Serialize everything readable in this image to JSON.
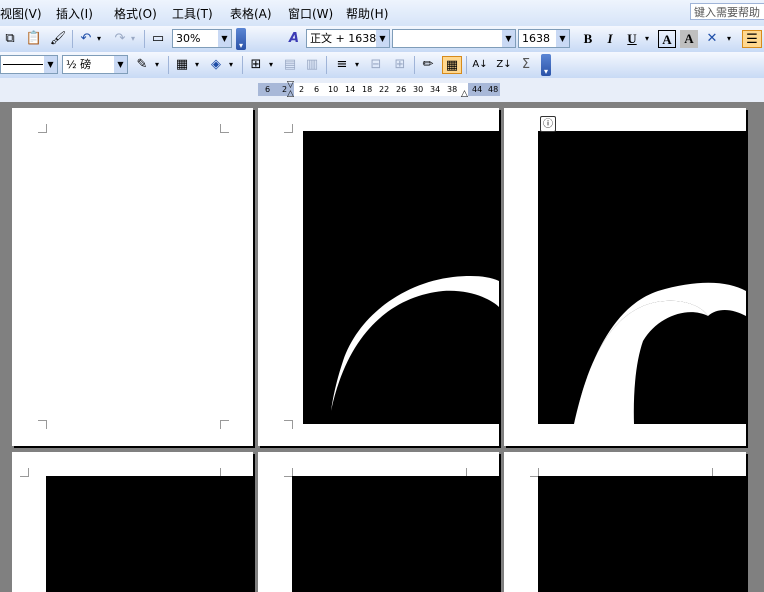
{
  "menubar": {
    "items": [
      "视图(V)",
      "插入(I)",
      "格式(O)",
      "工具(T)",
      "表格(A)",
      "窗口(W)",
      "帮助(H)"
    ],
    "help_search": "键入需要帮助"
  },
  "toolbar1": {
    "zoom": "30%",
    "style": "正文 + 1638",
    "font": "",
    "font_size": "1638",
    "bold": "B",
    "italic": "I",
    "underline": "U",
    "char_border": "A",
    "char_shade": "A"
  },
  "toolbar2": {
    "line_weight": "½ 磅",
    "sort_label": "Σ"
  },
  "ruler": {
    "ticks": [
      "6",
      "2",
      "2",
      "6",
      "10",
      "14",
      "18",
      "22",
      "26",
      "30",
      "34",
      "38",
      "44",
      "48"
    ]
  },
  "colors": {
    "toolbar_bg": "#c8daf5",
    "page_bg": "#ffffff",
    "canvas_bg": "#808080",
    "shape_fill": "#000000"
  }
}
